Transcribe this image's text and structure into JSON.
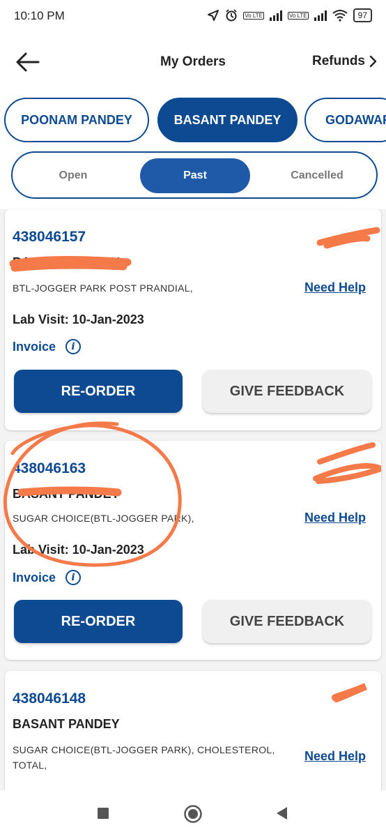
{
  "status_bar": {
    "time": "10:10 PM",
    "lte_label": "Vo LTE",
    "battery": "97",
    "icons": [
      "location-icon",
      "alarm-icon",
      "signal-icon",
      "wifi-icon",
      "battery-icon"
    ]
  },
  "header": {
    "title": "My Orders",
    "refunds_label": "Refunds",
    "back_icon": "back-arrow-icon"
  },
  "patients": [
    {
      "name": "POONAM PANDEY",
      "selected": false
    },
    {
      "name": "BASANT PANDEY",
      "selected": true
    },
    {
      "name": "GODAWARI",
      "selected": false
    }
  ],
  "tabs": [
    {
      "label": "Open",
      "selected": false
    },
    {
      "label": "Past",
      "selected": true
    },
    {
      "label": "Cancelled",
      "selected": false
    }
  ],
  "orders": [
    {
      "order_id": "438046157",
      "patient_name": "BASANT PANDEY",
      "tests": "BTL-JOGGER PARK POST PRANDIAL,",
      "need_help": "Need Help",
      "lab_visit": "Lab Visit: 10-Jan-2023",
      "invoice": "Invoice",
      "reorder_label": "RE-ORDER",
      "feedback_label": "GIVE FEEDBACK"
    },
    {
      "order_id": "438046163",
      "patient_name": "BASANT PANDEY",
      "tests": "SUGAR CHOICE(BTL-JOGGER PARK),",
      "need_help": "Need Help",
      "lab_visit": "Lab Visit: 10-Jan-2023",
      "invoice": "Invoice",
      "reorder_label": "RE-ORDER",
      "feedback_label": "GIVE FEEDBACK"
    },
    {
      "order_id": "438046148",
      "patient_name": "BASANT PANDEY",
      "tests": "SUGAR CHOICE(BTL-JOGGER PARK), CHOLESTEROL, TOTAL,",
      "need_help": "Need Help"
    }
  ],
  "annotation_color": "#f47a4a",
  "brand_color": "#0d4a91"
}
